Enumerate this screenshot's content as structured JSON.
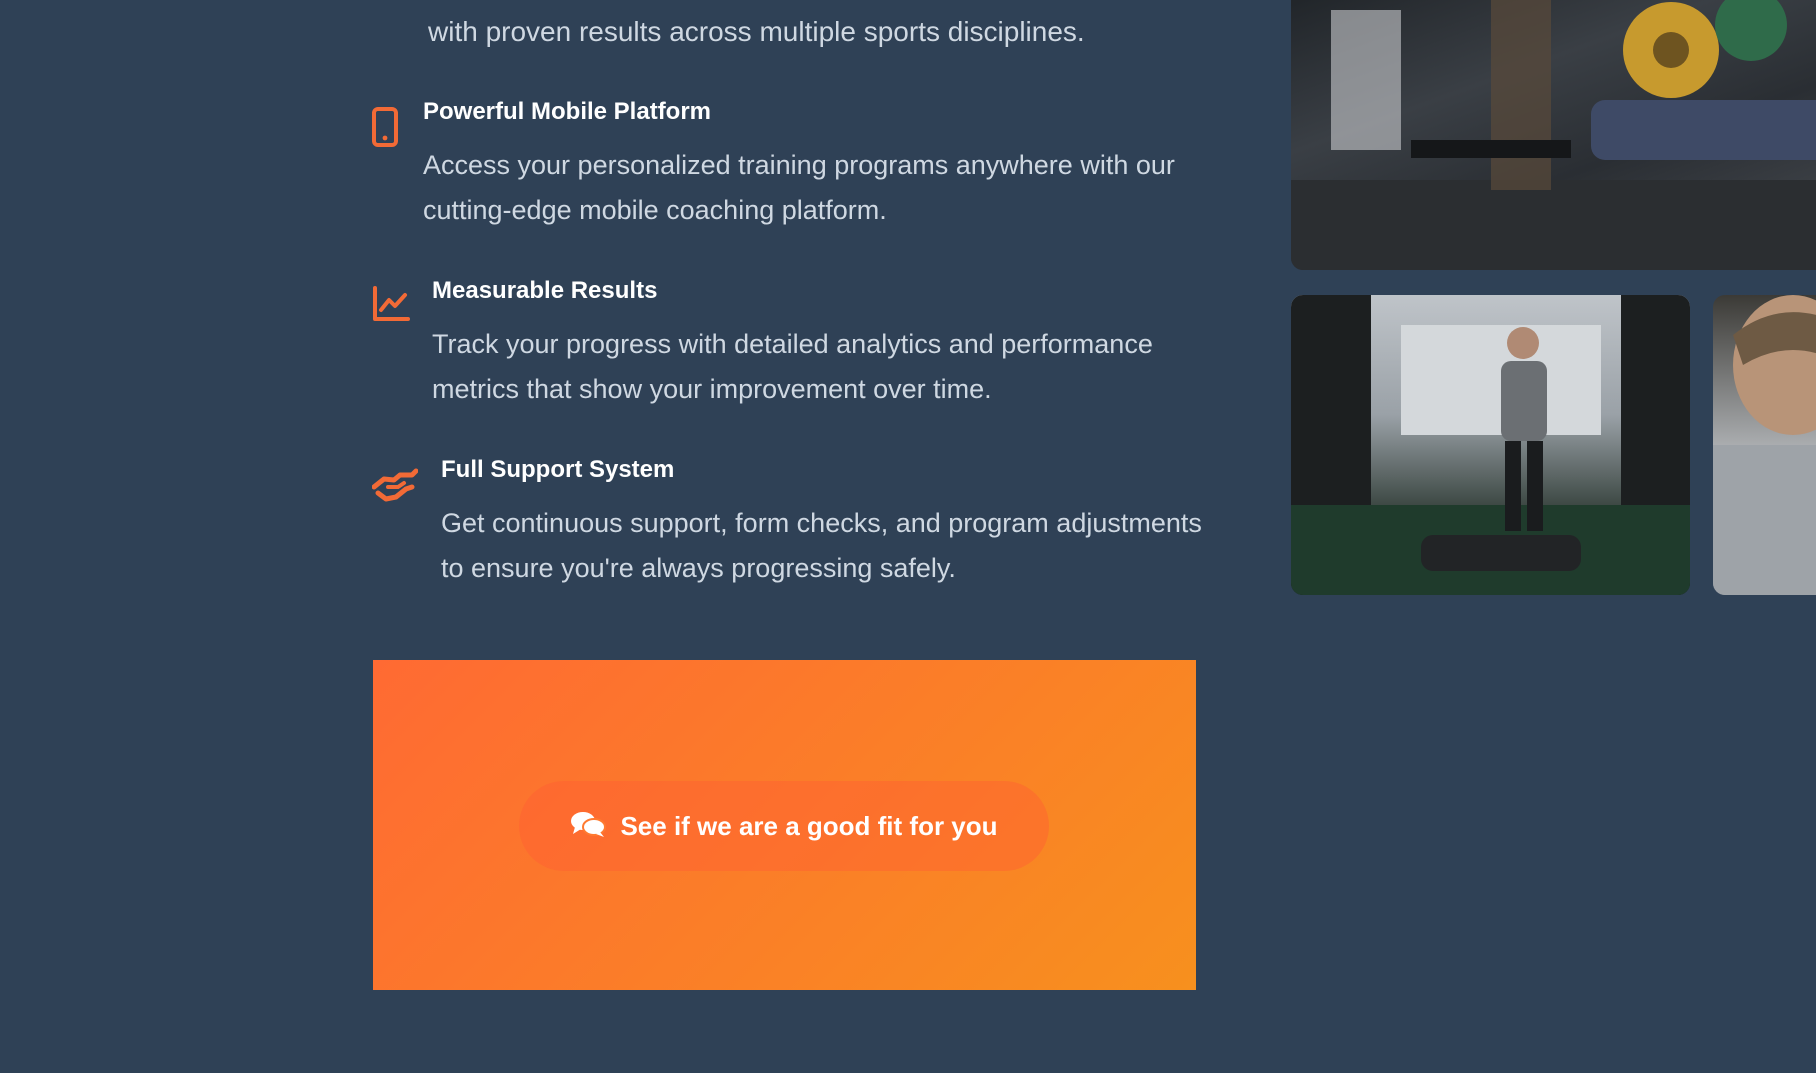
{
  "intro": {
    "tail_text": "with proven results across multiple sports disciplines."
  },
  "features": [
    {
      "icon": "smartphone-icon",
      "title": "Powerful Mobile Platform",
      "description": "Access your personalized training programs anywhere with our cutting-edge mobile coaching platform."
    },
    {
      "icon": "line-chart-icon",
      "title": "Measurable Results",
      "description": "Track your progress with detailed analytics and performance metrics that show your improvement over time."
    },
    {
      "icon": "handshake-icon",
      "title": "Full Support System",
      "description": "Get continuous support, form checks, and program adjustments to ensure you're always progressing safely."
    }
  ],
  "cta": {
    "icon": "chat-bubbles-icon",
    "label": "See if we are a good fit for you"
  },
  "colors": {
    "background": "#2f4156",
    "accent": "#ff6a33",
    "accent_end": "#f7901e",
    "heading": "#ffffff",
    "body_text": "#cfd8e2"
  }
}
